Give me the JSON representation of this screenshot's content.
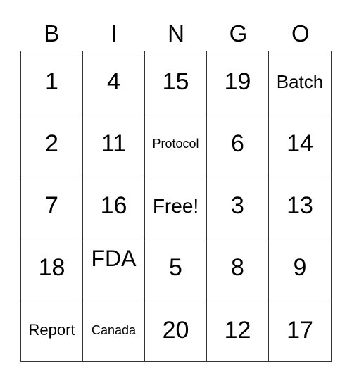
{
  "header": [
    "B",
    "I",
    "N",
    "G",
    "O"
  ],
  "cells": [
    [
      "1",
      "4",
      "15",
      "19",
      "Batch"
    ],
    [
      "2",
      "11",
      "Protocol",
      "6",
      "14"
    ],
    [
      "7",
      "16",
      "Free!",
      "3",
      "13"
    ],
    [
      "18",
      "FDA",
      "5",
      "8",
      "9"
    ],
    [
      "Report",
      "Canada",
      "20",
      "12",
      "17"
    ]
  ]
}
